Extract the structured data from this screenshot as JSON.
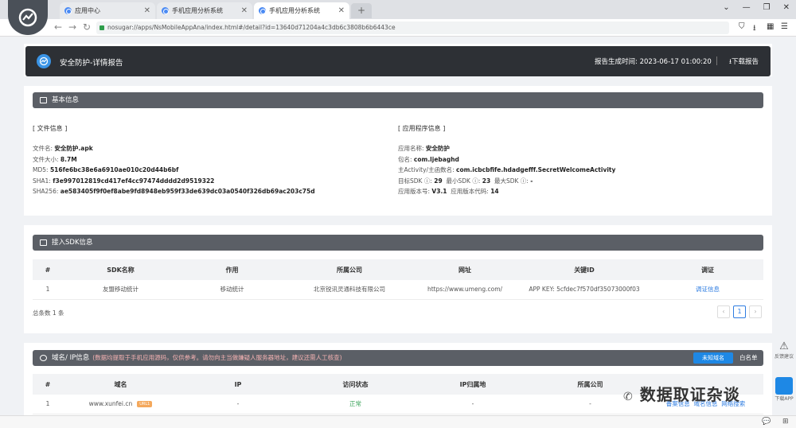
{
  "browser": {
    "tabs": [
      {
        "title": "应用中心"
      },
      {
        "title": "手机应用分析系统"
      },
      {
        "title": "手机应用分析系统"
      }
    ],
    "url": "nosugar://apps/NsMobileAppAna/index.html#/detail?id=13640d71204a4c3db6c3808b6b6443ce"
  },
  "header": {
    "title": "安全防护-详情报告",
    "time_label": "报告生成时间: 2023-06-17 01:00:20",
    "download_label": "下载报告"
  },
  "basic": {
    "section_title": "基本信息",
    "file": {
      "group": "[ 文件信息 ]",
      "rows": [
        {
          "label": "文件名:",
          "value": "安全防护.apk"
        },
        {
          "label": "文件大小:",
          "value": "8.7M"
        },
        {
          "label": "MD5:",
          "value": "516fe6bc38e6a6910ae010c20d44b6bf"
        },
        {
          "label": "SHA1:",
          "value": "f3e997012819cd417ef4cc97474dddd2d9519322"
        },
        {
          "label": "SHA256:",
          "value": "ae583405f9f0ef8abe9fd8948eb959f33de639dc03a0540f326db69ac203c75d"
        }
      ]
    },
    "app": {
      "group": "[ 应用程序信息 ]",
      "name_label": "应用名称:",
      "name_value": "安全防护",
      "pkg_label": "包名:",
      "pkg_value": "com.ljebaghd",
      "activity_label": "主Activity/主函数名:",
      "activity_value": "com.icbcbfife.hdadgefff.SecretWelcomeActivity",
      "target_label": "目标SDK ⓘ:",
      "target_value": "29",
      "min_label": "最小SDK ⓘ:",
      "min_value": "23",
      "max_label": "最大SDK ⓘ:",
      "max_value": "-",
      "version_label": "应用版本号:",
      "version_value": "V3.1",
      "code_label": "应用版本代码:",
      "code_value": "14"
    }
  },
  "sdk": {
    "section_title": "接入SDK信息",
    "columns": [
      "#",
      "SDK名称",
      "作用",
      "所属公司",
      "网址",
      "关键ID",
      "调证"
    ],
    "rows": [
      {
        "n": "1",
        "name": "友盟移动统计",
        "role": "移动统计",
        "company": "北京锐讯灵通科技有限公司",
        "url": "https://www.umeng.com/",
        "key": "APP KEY: 5cfdec7f570df35073000f03",
        "action": "调证信息"
      }
    ],
    "total": "总条数 1 条",
    "page": "1"
  },
  "domain": {
    "section_title": "域名/ IP信息",
    "note": "(数据均提取于手机应用源码，仅供参考。请勿向主当做嫌疑人服务器地址，建议还需人工核查)",
    "btn_unknown": "未知域名",
    "btn_whitelist": "白名单",
    "columns": [
      "#",
      "域名",
      "IP",
      "访问状态",
      "IP归属地",
      "所属公司"
    ],
    "rows": [
      {
        "n": "1",
        "domain": "www.xunfei.cn",
        "badge": "URL1",
        "ip": "-",
        "status": "正常",
        "loc": "-",
        "company": "-",
        "a1": "备案信息",
        "a2": "域名信息",
        "a3": "网络搜索"
      }
    ]
  },
  "float": {
    "feedback": "反馈建议",
    "download": "下载APP"
  },
  "watermark": "数据取证杂谈"
}
